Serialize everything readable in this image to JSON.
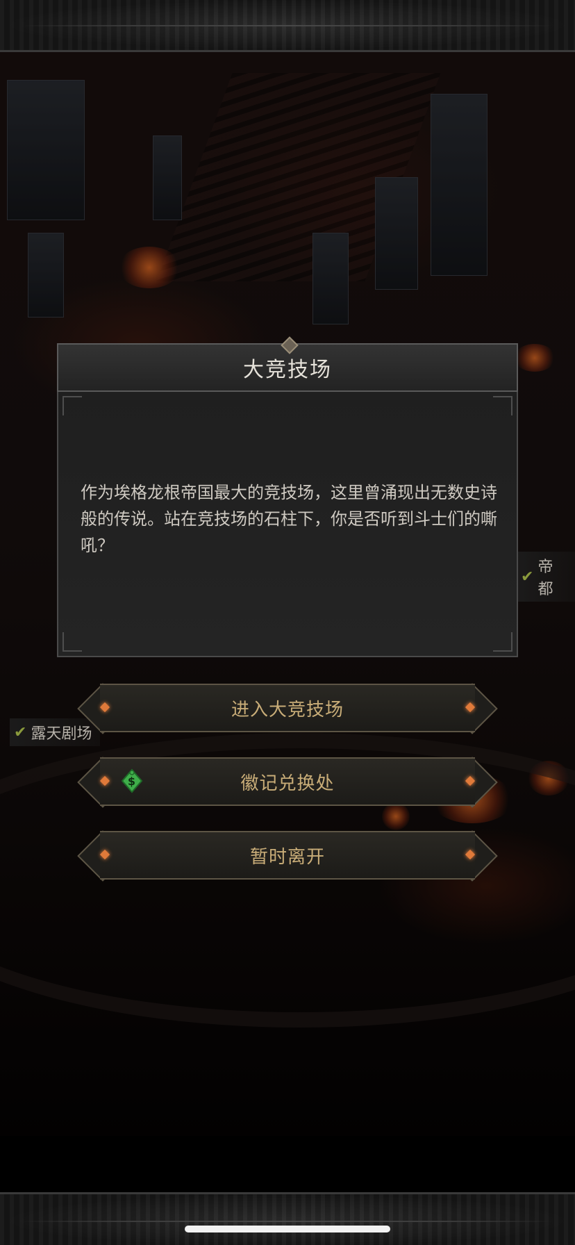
{
  "map": {
    "labels": [
      {
        "text": "帝都"
      },
      {
        "text": "露天剧场"
      }
    ]
  },
  "dialog": {
    "title": "大竞技场",
    "body": "作为埃格龙根帝国最大的竞技场，这里曾涌现出无数史诗般的传说。站在竞技场的石柱下，你是否听到斗士们的嘶吼？"
  },
  "options": [
    {
      "label": "进入大竞技场",
      "icon": null
    },
    {
      "label": "徽记兑换处",
      "icon": "money-bag-icon"
    },
    {
      "label": "暂时离开",
      "icon": null
    }
  ],
  "colors": {
    "option_text": "#c9ad78",
    "gem": "#e07a3a",
    "money_icon": "#3fae4a"
  }
}
